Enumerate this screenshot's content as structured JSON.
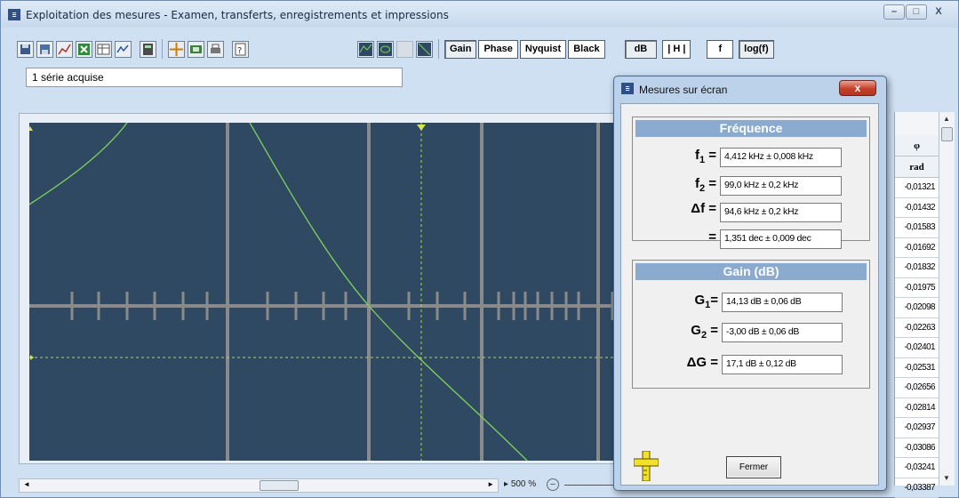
{
  "window": {
    "title": "Exploitation des mesures - Examen, transferts, enregistrements et impressions",
    "minimize": "–",
    "maximize": "□",
    "close": "X"
  },
  "toolbar": {
    "toggles": [
      "Gain",
      "Phase",
      "Nyquist",
      "Black",
      "dB",
      "| H |",
      "f",
      "log(f)"
    ]
  },
  "status": "1 série acquise",
  "table": {
    "col_symbol": "φ",
    "col_unit": "rad",
    "values": [
      "-0,01321",
      "-0,01432",
      "-0,01583",
      "-0,01692",
      "-0,01832",
      "-0,01975",
      "-0,02098",
      "-0,02263",
      "-0,02401",
      "-0,02531",
      "-0,02656",
      "-0,02814",
      "-0,02937",
      "-0,03086",
      "-0,03241",
      "-0,03387"
    ]
  },
  "bottom": {
    "zoom": "500 %"
  },
  "dialog": {
    "title": "Mesures sur écran",
    "close_glyph": "x",
    "freq_title": "Fréquence",
    "f1_label": "f",
    "f1_sub": "1",
    "f1_value": "4,412 kHz ± 0,008 kHz",
    "f2_label": "f",
    "f2_sub": "2",
    "f2_value": "99,0 kHz ± 0,2 kHz",
    "df_label": "Δf =",
    "df_value": "94,6 kHz ± 0,2 kHz",
    "dec_label": "=",
    "dec_value": "1,351 dec ± 0,009 dec",
    "gain_title": "Gain (dB)",
    "g1_label": "G",
    "g1_sub": "1",
    "g1_value": "14,13 dB ± 0,06 dB",
    "g2_label": "G",
    "g2_sub": "2",
    "g2_value": "-3,00 dB ± 0,06 dB",
    "dg_label": "ΔG =",
    "dg_value": "17,1 dB ± 0,12 dB",
    "eq": "=",
    "close_button": "Fermer"
  },
  "colors": {
    "plot_background": "#2f4963",
    "plot_grid": "#8a8a8a",
    "curve": "#7ed35a",
    "cursor": "#d4e655",
    "group_header": "#8aaad0"
  }
}
